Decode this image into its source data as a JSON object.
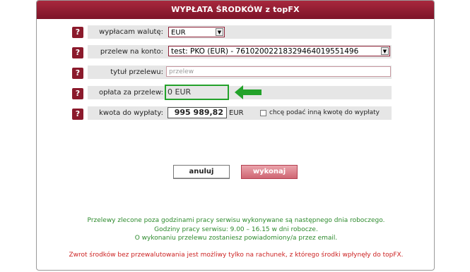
{
  "header": {
    "title": "WYPŁATA ŚRODKÓW z topFX"
  },
  "help_glyph": "?",
  "fields": {
    "currency": {
      "label": "wypłacam walutę:",
      "value": "EUR"
    },
    "account": {
      "label": "przelew na konto:",
      "value": "test: PKO (EUR) - 76102002218329464019551496"
    },
    "title": {
      "label": "tytuł przelewu:",
      "placeholder": "przelew"
    },
    "fee": {
      "label": "opłata za przelew:",
      "value": "0 EUR"
    },
    "amount": {
      "label": "kwota do wypłaty:",
      "value": "995 989,82",
      "currency": "EUR",
      "checkbox_label": "chcę podać inną kwotę do wypłaty",
      "checked": false
    }
  },
  "buttons": {
    "cancel": "anuluj",
    "submit": "wykonaj"
  },
  "info": {
    "line1": "Przelewy zlecone poza godzinami pracy serwisu wykonywane są następnego dnia roboczego.",
    "line2": "Godziny pracy serwisu: 9.00 – 16.15 w dni robocze.",
    "line3": "O wykonaniu przelewu zostaniesz powiadomiony/a przez email."
  },
  "warning": "Zwrot środków bez przewalutowania jest możliwy tylko na rachunek, z którego środki wpłynęły do topFX.",
  "colors": {
    "header": "#8c1a2e",
    "info_text": "#2d8a2d",
    "warning_text": "#cc2222",
    "highlight": "#23a22a"
  }
}
